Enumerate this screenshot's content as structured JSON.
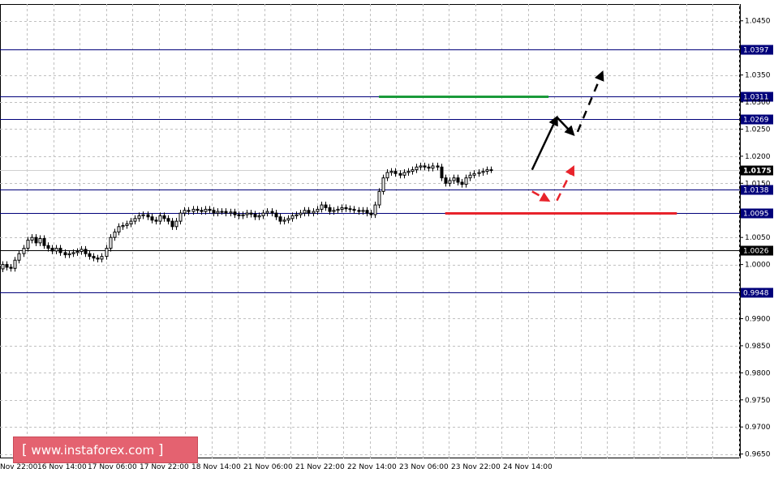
{
  "chart_data": {
    "type": "candlestick",
    "y_axis": {
      "ylim": [
        0.9642,
        1.0481
      ],
      "ticks": [
        "1.0450",
        "1.0350",
        "1.0300",
        "1.0250",
        "1.0200",
        "1.0150",
        "1.0050",
        "1.0000",
        "0.9900",
        "0.9850",
        "0.9800",
        "0.9750",
        "0.9700",
        "0.9650"
      ]
    },
    "x_axis": {
      "tick_labels": [
        "Nov 22:00",
        "16 Nov 14:00",
        "17 Nov 06:00",
        "17 Nov 22:00",
        "18 Nov 14:00",
        "21 Nov 06:00",
        "21 Nov 22:00",
        "22 Nov 14:00",
        "23 Nov 06:00",
        "23 Nov 22:00",
        "24 Nov 14:00"
      ]
    },
    "levels": [
      {
        "value": 1.0397,
        "label": "1.0397",
        "color": "#00007a"
      },
      {
        "value": 1.0311,
        "label": "1.0311",
        "color": "#00007a"
      },
      {
        "value": 1.0269,
        "label": "1.0269",
        "color": "#00007a"
      },
      {
        "value": 1.0138,
        "label": "1.0138",
        "color": "#00007a"
      },
      {
        "value": 1.0095,
        "label": "1.0095",
        "color": "#00007a"
      },
      {
        "value": 1.0026,
        "label": "1.0026",
        "color": "#000000"
      },
      {
        "value": 0.9948,
        "label": "0.9948",
        "color": "#00007a"
      }
    ],
    "last_price": {
      "value": 1.0175,
      "label": "1.0175"
    },
    "highlight_lines": [
      {
        "value": 1.0311,
        "color": "#1a9a3a",
        "from_bar": 91,
        "to_bar": 132
      },
      {
        "value": 1.0095,
        "color": "#e8232b",
        "from_bar": 107,
        "to_bar": 163
      }
    ],
    "candles_close": [
      1.0,
      0.9995,
      0.9993,
      1.0008,
      1.002,
      1.003,
      1.0045,
      1.005,
      1.004,
      1.0048,
      1.0035,
      1.003,
      1.0025,
      1.003,
      1.0022,
      1.0018,
      1.002,
      1.0022,
      1.0024,
      1.0028,
      1.002,
      1.0015,
      1.0012,
      1.001,
      1.0015,
      1.003,
      1.005,
      1.006,
      1.007,
      1.0072,
      1.0075,
      1.008,
      1.0085,
      1.009,
      1.0092,
      1.0088,
      1.0082,
      1.008,
      1.009,
      1.0085,
      1.008,
      1.007,
      1.008,
      1.0095,
      1.01,
      1.0098,
      1.0102,
      1.01,
      1.0098,
      1.0102,
      1.01,
      1.0095,
      1.0098,
      1.0098,
      1.0095,
      1.0097,
      1.0092,
      1.009,
      1.0092,
      1.0095,
      1.0093,
      1.0088,
      1.009,
      1.0095,
      1.0098,
      1.0095,
      1.0088,
      1.008,
      1.0082,
      1.0085,
      1.009,
      1.0092,
      1.0095,
      1.01,
      1.0095,
      1.0098,
      1.0102,
      1.011,
      1.0105,
      1.0098,
      1.01,
      1.0102,
      1.0105,
      1.0103,
      1.0102,
      1.01,
      1.0098,
      1.01,
      1.0095,
      1.0092,
      1.011,
      1.0135,
      1.016,
      1.017,
      1.0172,
      1.0168,
      1.0165,
      1.017,
      1.0172,
      1.0175,
      1.018,
      1.0182,
      1.018,
      1.0178,
      1.0182,
      1.018,
      1.016,
      1.015,
      1.0155,
      1.016,
      1.0152,
      1.0148,
      1.016,
      1.0165,
      1.0168,
      1.017,
      1.0172,
      1.0175,
      1.0175
    ]
  },
  "forecast_arrows": [
    {
      "color": "#000000",
      "style": "solid",
      "from": [
        128,
        1.0175
      ],
      "to": [
        134,
        1.0272
      ]
    },
    {
      "color": "#000000",
      "style": "solid",
      "from": [
        134,
        1.0272
      ],
      "to": [
        138,
        1.024
      ]
    },
    {
      "color": "#000000",
      "style": "dashed",
      "from": [
        139,
        1.0245
      ],
      "to": [
        145,
        1.0355
      ]
    },
    {
      "color": "#e8232b",
      "style": "dashed",
      "from": [
        128,
        1.0135
      ],
      "to": [
        132,
        1.0118
      ]
    },
    {
      "color": "#e8232b",
      "style": "dashed",
      "from": [
        134,
        1.0118
      ],
      "to": [
        138,
        1.018
      ]
    }
  ],
  "watermark": {
    "open": "[",
    "text": "www.instaforex.com",
    "close": "]"
  }
}
